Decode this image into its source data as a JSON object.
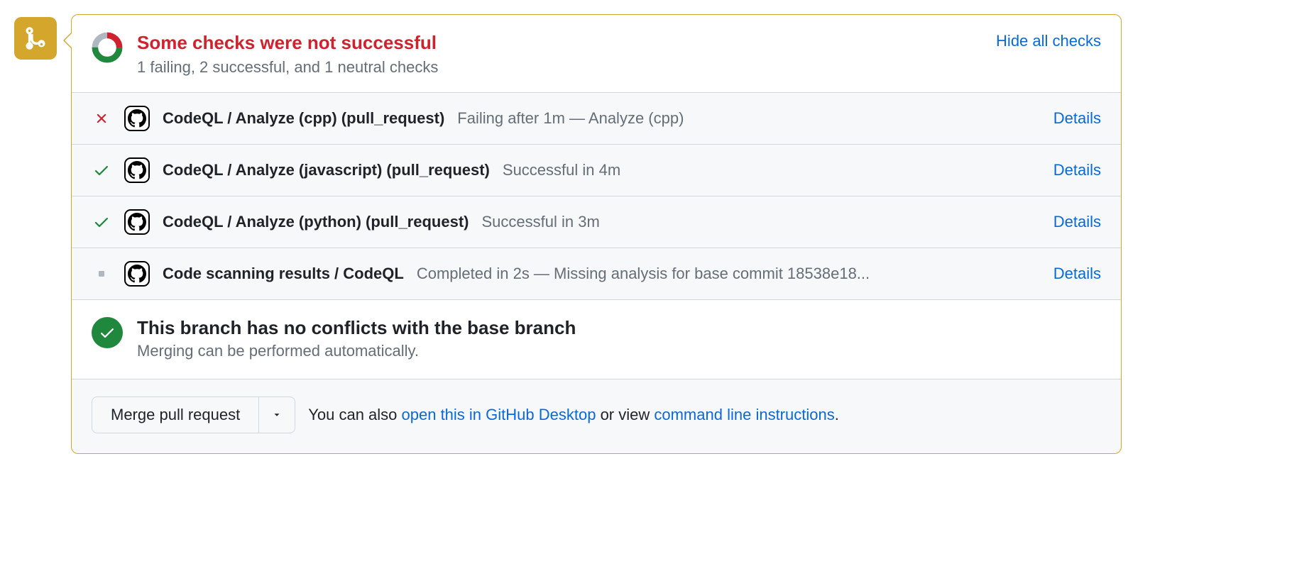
{
  "status": {
    "title": "Some checks were not successful",
    "subtitle": "1 failing, 2 successful, and 1 neutral checks",
    "hide_label": "Hide all checks",
    "donut_segments": {
      "fail_deg": 90,
      "success_deg": 180,
      "neutral_deg": 90,
      "colors": {
        "fail": "#cf222e",
        "neutral": "#afb8c1",
        "success": "#1f883d"
      }
    }
  },
  "checks": [
    {
      "state": "fail",
      "name": "CodeQL / Analyze (cpp) (pull_request)",
      "detail": "Failing after 1m — Analyze (cpp)",
      "details_label": "Details"
    },
    {
      "state": "success",
      "name": "CodeQL / Analyze (javascript) (pull_request)",
      "detail": "Successful in 4m",
      "details_label": "Details"
    },
    {
      "state": "success",
      "name": "CodeQL / Analyze (python) (pull_request)",
      "detail": "Successful in 3m",
      "details_label": "Details"
    },
    {
      "state": "neutral",
      "name": "Code scanning results / CodeQL",
      "detail": "Completed in 2s — Missing analysis for base commit 18538e18...",
      "details_label": "Details"
    }
  ],
  "conflict": {
    "title": "This branch has no conflicts with the base branch",
    "subtitle": "Merging can be performed automatically."
  },
  "merge": {
    "button_label": "Merge pull request",
    "text_prefix": "You can also ",
    "link_desktop": "open this in GitHub Desktop",
    "text_middle": " or view ",
    "link_cli": "command line instructions",
    "text_suffix": "."
  }
}
